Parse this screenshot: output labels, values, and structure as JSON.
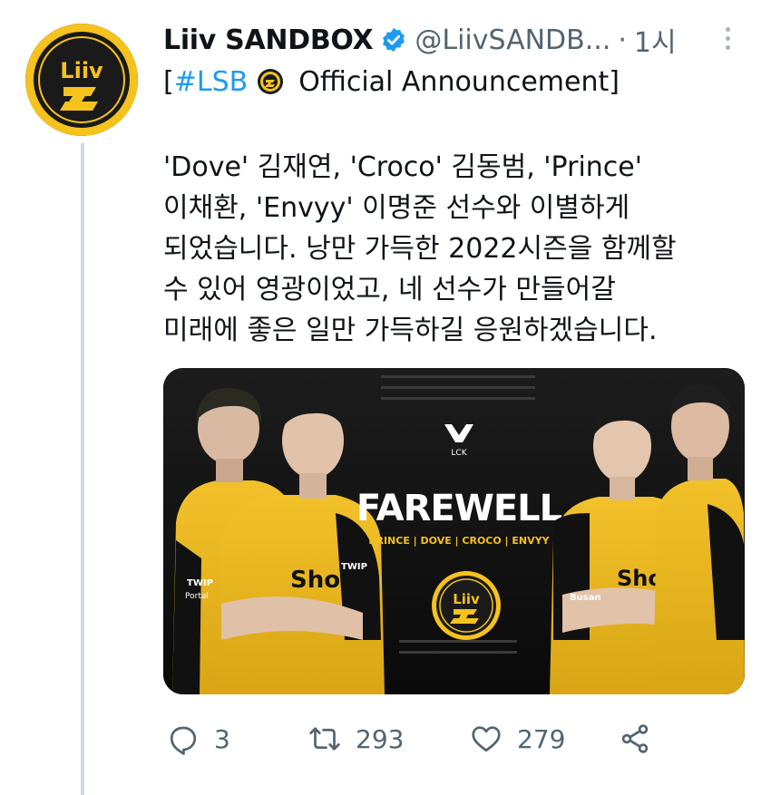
{
  "tweet": {
    "display_name": "Liiv SANDBOX",
    "handle": "@LiivSANDB...",
    "dot": "·",
    "time": "1시",
    "hashtag": "#LSB",
    "open_bracket": "[",
    "close_bracket": "]",
    "announcement": "Official Announcement",
    "body_lines": [
      "'Dove' 김재연, 'Croco' 김동범, 'Prince'",
      "이채환, 'Envyy' 이명준 선수와 이별하게",
      "되었습니다. 낭만 가득한 2022시즌을 함께할",
      "수 있어 영광이었고, 네 선수가 만들어갈",
      "미래에 좋은 일만 가득하길 응원하겠습니다."
    ],
    "avatar_logo_text": "Liiv",
    "media": {
      "league": "LCK",
      "headline": "FAREWELL",
      "players_line": "PRINCE | DOVE | CROCO | ENVYY",
      "logo_text": "Liiv",
      "jersey_sponsor": "Sho",
      "jersey_patch_1": "TWIP",
      "jersey_patch_2": "Portal",
      "jersey_patch_3": "Busan"
    },
    "actions": {
      "reply_count": "3",
      "retweet_count": "293",
      "like_count": "279"
    }
  },
  "colors": {
    "brand_gold": "#f6c21c",
    "link_blue": "#1d9bf0",
    "text_gray": "#536471"
  },
  "icons": [
    "verified-badge-icon",
    "more-options-icon",
    "reply-icon",
    "retweet-icon",
    "like-icon",
    "share-icon"
  ]
}
